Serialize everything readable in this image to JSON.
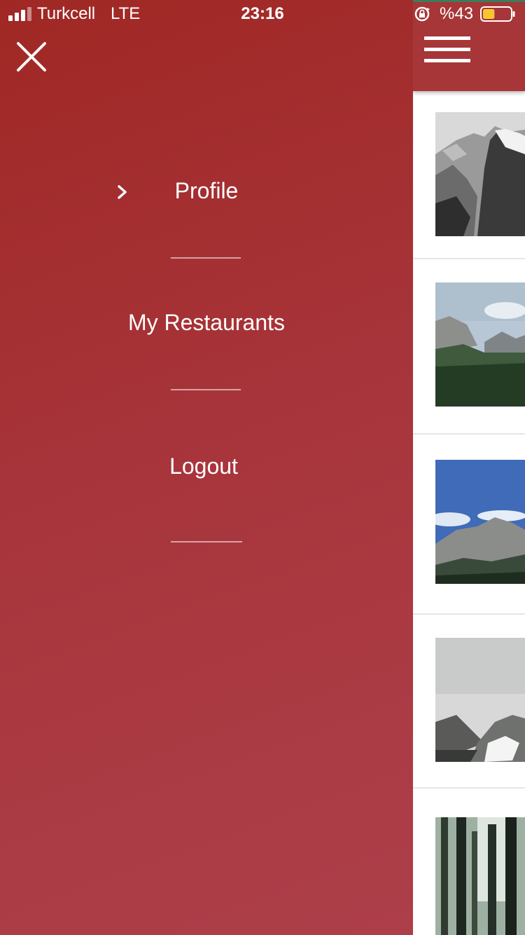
{
  "status_bar": {
    "carrier": "Turkcell",
    "network": "LTE",
    "time": "23:16",
    "battery_percent": "%43",
    "battery_level": 0.43,
    "signal_bars_active": 3
  },
  "drawer": {
    "menu": [
      {
        "label": "Profile",
        "selected": true
      },
      {
        "label": "My Restaurants",
        "selected": false
      },
      {
        "label": "Logout",
        "selected": false
      }
    ],
    "colors": {
      "background_start": "#a02824",
      "background_end": "#ad3f4a"
    }
  },
  "content": {
    "appbar_color": "#a63637",
    "cards": [
      {
        "image": "half-dome-bw"
      },
      {
        "image": "yosemite-valley"
      },
      {
        "image": "mountain-blue-sky"
      },
      {
        "image": "foggy-valley"
      },
      {
        "image": "forest-trees"
      }
    ]
  }
}
